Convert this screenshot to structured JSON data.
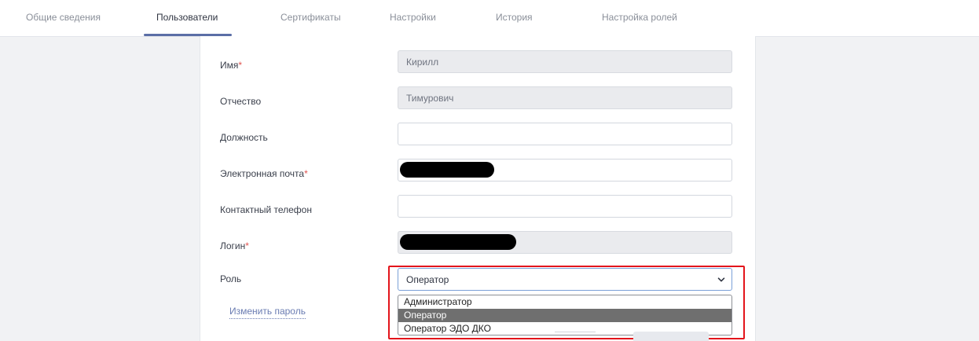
{
  "tabs": {
    "general": "Общие сведения",
    "users": "Пользователи",
    "certificates": "Сертификаты",
    "settings": "Настройки",
    "history": "История",
    "roles": "Настройка ролей"
  },
  "form": {
    "first_name": {
      "label": "Имя",
      "required_mark": "*",
      "value": "Кирилл"
    },
    "patronymic": {
      "label": "Отчество",
      "value": "Тимурович"
    },
    "position": {
      "label": "Должность",
      "value": ""
    },
    "email": {
      "label": "Электронная почта",
      "required_mark": "*"
    },
    "phone": {
      "label": "Контактный телефон",
      "value": ""
    },
    "login": {
      "label": "Логин",
      "required_mark": "*"
    },
    "role": {
      "label": "Роль",
      "selected": "Оператор",
      "options": [
        "Администратор",
        "Оператор",
        "Оператор ЭДО ДКО"
      ]
    },
    "change_password": "Изменить пароль"
  },
  "colors": {
    "accent": "#5b6ea6",
    "required": "#e0534f",
    "highlight": "#e3141b",
    "selected_option_bg": "#6f6f6f"
  },
  "icons": {
    "select_chevron": "chevron-down-icon"
  }
}
